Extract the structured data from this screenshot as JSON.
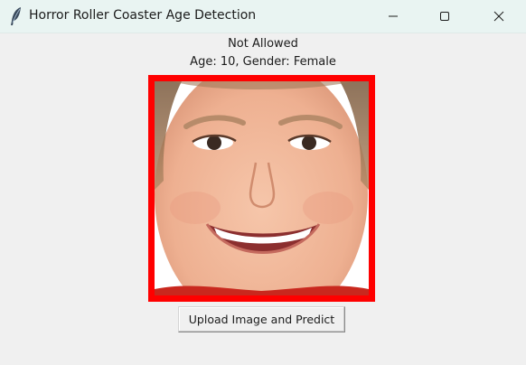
{
  "window": {
    "title": "Horror Roller Coaster Age Detection",
    "app_icon": "feather-icon",
    "controls": [
      "minimize-icon",
      "maximize-icon",
      "close-icon"
    ]
  },
  "result": {
    "status": "Not Allowed",
    "details": "Age: 10, Gender: Female",
    "frame_color": "#ff0000"
  },
  "image": {
    "content": "face-photo"
  },
  "actions": {
    "upload_label": "Upload Image and Predict"
  }
}
